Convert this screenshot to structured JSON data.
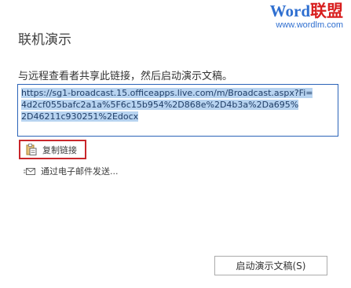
{
  "watermark": {
    "word": "Word",
    "cn": "联盟",
    "url": "www.wordlm.com"
  },
  "dialog": {
    "title": "联机演示",
    "description": "与远程查看者共享此链接，然后启动演示文稿。",
    "link_lines": [
      "https://sg1-broadcast.15.officeapps.live.com/m/Broadcast.aspx?Fi=",
      "4d2cf055bafc2a1a%5F6c15b954%2D868e%2D4b3a%2Da695%",
      "2D46211c930251%2Edocx"
    ],
    "copy_link_label": "复制链接",
    "send_email_label": "通过电子邮件发送...",
    "start_button_label": "启动演示文稿(S)"
  }
}
